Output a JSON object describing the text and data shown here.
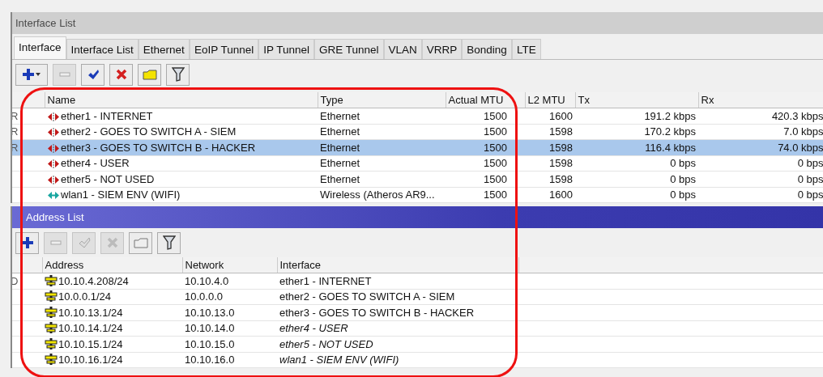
{
  "interface_window": {
    "title": "Interface List",
    "tabs": [
      {
        "label": "Interface",
        "selected": true
      },
      {
        "label": "Interface List",
        "selected": false
      },
      {
        "label": "Ethernet",
        "selected": false
      },
      {
        "label": "EoIP Tunnel",
        "selected": false
      },
      {
        "label": "IP Tunnel",
        "selected": false
      },
      {
        "label": "GRE Tunnel",
        "selected": false
      },
      {
        "label": "VLAN",
        "selected": false
      },
      {
        "label": "VRRP",
        "selected": false
      },
      {
        "label": "Bonding",
        "selected": false
      },
      {
        "label": "LTE",
        "selected": false
      }
    ],
    "toolbar": [
      {
        "kind": "add",
        "disabled": false
      },
      {
        "kind": "remove",
        "disabled": true
      },
      {
        "kind": "enable",
        "disabled": false
      },
      {
        "kind": "disable",
        "disabled": false
      },
      {
        "kind": "comment",
        "disabled": false
      },
      {
        "kind": "filter",
        "disabled": false
      }
    ],
    "columns": [
      "Name",
      "Type",
      "Actual MTU",
      "L2 MTU",
      "Tx",
      "Rx"
    ],
    "rows": [
      {
        "flag": "R",
        "kind": "ethernet",
        "name": "ether1 - INTERNET",
        "type": "Ethernet",
        "actual_mtu": "1500",
        "l2_mtu": "1600",
        "tx": "191.2 kbps",
        "rx": "420.3 kbps",
        "selected": false
      },
      {
        "flag": "R",
        "kind": "ethernet",
        "name": "ether2 - GOES TO SWITCH A - SIEM",
        "type": "Ethernet",
        "actual_mtu": "1500",
        "l2_mtu": "1598",
        "tx": "170.2 kbps",
        "rx": "7.0 kbps",
        "selected": false
      },
      {
        "flag": "R",
        "kind": "ethernet",
        "name": "ether3 - GOES TO SWITCH B - HACKER",
        "type": "Ethernet",
        "actual_mtu": "1500",
        "l2_mtu": "1598",
        "tx": "116.4 kbps",
        "rx": "74.0 kbps",
        "selected": true
      },
      {
        "kind": "ethernet",
        "name": "ether4 - USER",
        "type": "Ethernet",
        "actual_mtu": "1500",
        "l2_mtu": "1598",
        "tx": "0 bps",
        "rx": "0 bps",
        "selected": false
      },
      {
        "kind": "ethernet",
        "name": "ether5 - NOT USED",
        "type": "Ethernet",
        "actual_mtu": "1500",
        "l2_mtu": "1598",
        "tx": "0 bps",
        "rx": "0 bps",
        "selected": false
      },
      {
        "kind": "wireless",
        "name": "wlan1 - SIEM ENV (WIFI)",
        "type": "Wireless (Atheros AR9...",
        "actual_mtu": "1500",
        "l2_mtu": "1600",
        "tx": "0 bps",
        "rx": "0 bps",
        "selected": false
      }
    ]
  },
  "address_window": {
    "title": "Address List",
    "toolbar": [
      {
        "kind": "add",
        "disabled": false
      },
      {
        "kind": "remove",
        "disabled": true
      },
      {
        "kind": "enable",
        "disabled": true
      },
      {
        "kind": "disable",
        "disabled": true
      },
      {
        "kind": "comment",
        "disabled": false
      },
      {
        "kind": "filter",
        "disabled": false
      }
    ],
    "columns": [
      "Address",
      "Network",
      "Interface"
    ],
    "rows": [
      {
        "flag": "D",
        "address": "10.10.4.208/24",
        "network": "10.10.4.0",
        "interface": "ether1 - INTERNET",
        "inactive": false
      },
      {
        "address": "10.0.0.1/24",
        "network": "10.0.0.0",
        "interface": "ether2 - GOES TO SWITCH A - SIEM",
        "inactive": false
      },
      {
        "address": "10.10.13.1/24",
        "network": "10.10.13.0",
        "interface": "ether3 - GOES TO SWITCH B - HACKER",
        "inactive": false
      },
      {
        "address": "10.10.14.1/24",
        "network": "10.10.14.0",
        "interface": "ether4 - USER",
        "inactive": true
      },
      {
        "address": "10.10.15.1/24",
        "network": "10.10.15.0",
        "interface": "ether5 - NOT USED",
        "inactive": true
      },
      {
        "address": "10.10.16.1/24",
        "network": "10.10.16.0",
        "interface": "wlan1 - SIEM ENV (WIFI)",
        "inactive": true
      }
    ]
  }
}
